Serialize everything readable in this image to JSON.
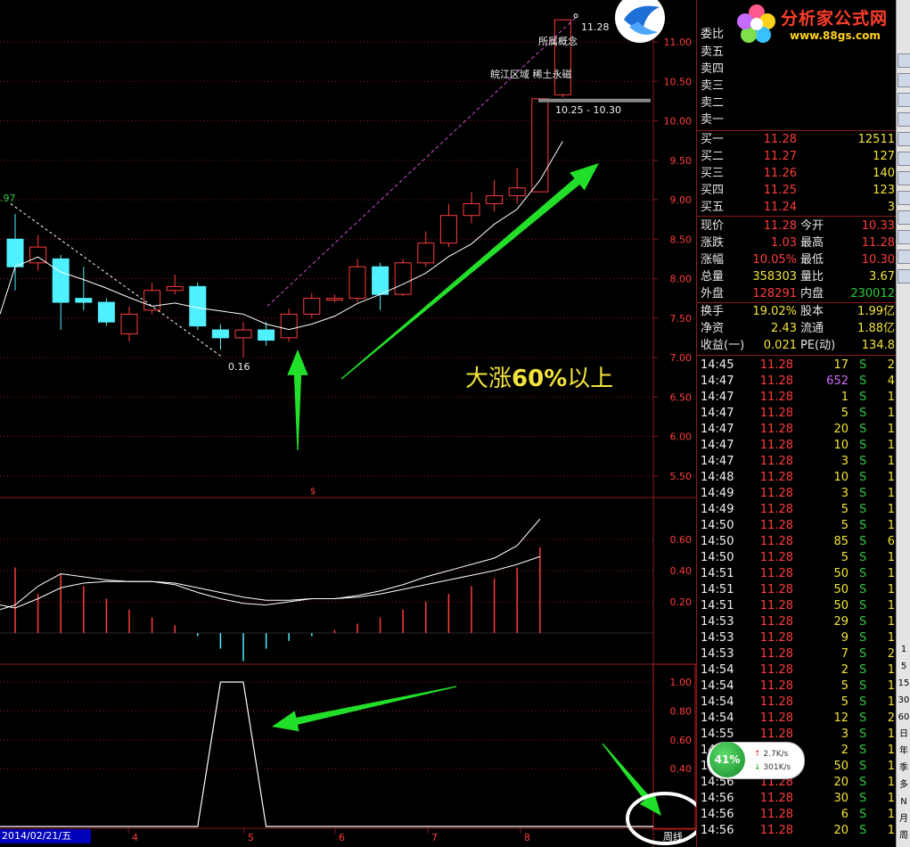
{
  "annotations": {
    "concept": "所属概念",
    "region": "皖江区域 稀土永磁",
    "high_price": "11.28",
    "range": "10.25 - 10.30",
    "low_price": "0.16",
    "left_price": ".97",
    "big_text_prefix": "大涨",
    "big_text_bold": "60%",
    "big_text_suffix": "以上",
    "dollar": "$",
    "period": "周线"
  },
  "x_axis": {
    "date": "2014/02/21/五",
    "ticks": [
      "4",
      "5",
      "6",
      "7",
      "8"
    ]
  },
  "price_axis": [
    "11.00",
    "10.50",
    "10.00",
    "9.50",
    "9.00",
    "8.50",
    "8.00",
    "7.50",
    "7.00",
    "6.50",
    "6.00",
    "5.50"
  ],
  "macd_axis": [
    "0.60",
    "0.40",
    "0.20"
  ],
  "ind_axis": [
    "1.00",
    "0.80",
    "0.60",
    "0.40"
  ],
  "colors": {
    "up": "#ff3c3c",
    "down": "#4ff0ff",
    "grid": "#8a1a1a",
    "ma": "#ffffff",
    "arrow": "#22e02a"
  },
  "logo": {
    "title": "分析家公式网",
    "url": "www.88gs.com"
  },
  "order_book": {
    "weibi_label": "委比",
    "asks": [
      {
        "label": "卖五"
      },
      {
        "label": "卖四"
      },
      {
        "label": "卖三"
      },
      {
        "label": "卖二"
      },
      {
        "label": "卖一"
      }
    ],
    "bids": [
      {
        "label": "买一",
        "price": "11.28",
        "vol": "12511"
      },
      {
        "label": "买二",
        "price": "11.27",
        "vol": "127"
      },
      {
        "label": "买三",
        "price": "11.26",
        "vol": "140"
      },
      {
        "label": "买四",
        "price": "11.25",
        "vol": "123"
      },
      {
        "label": "买五",
        "price": "11.24",
        "vol": "3"
      }
    ]
  },
  "stats": [
    {
      "l1": "现价",
      "v1": "11.28",
      "l2": "今开",
      "v2": "10.33"
    },
    {
      "l1": "涨跌",
      "v1": "1.03",
      "l2": "最高",
      "v2": "11.28"
    },
    {
      "l1": "涨幅",
      "v1": "10.05%",
      "l2": "最低",
      "v2": "10.30"
    },
    {
      "l1": "总量",
      "v1": "358303",
      "l2": "量比",
      "v2": "3.67"
    },
    {
      "l1": "外盘",
      "v1": "128291",
      "l2": "内盘",
      "v2": "230012"
    },
    {
      "l1": "换手",
      "v1": "19.02%",
      "l2": "股本",
      "v2": "1.99亿"
    },
    {
      "l1": "净资",
      "v1": "2.43",
      "l2": "流通",
      "v2": "1.88亿"
    },
    {
      "l1": "收益(一)",
      "v1": "0.021",
      "l2": "PE(动)",
      "v2": "134.8"
    }
  ],
  "ticks": [
    {
      "t": "14:45",
      "p": "11.28",
      "v": "17",
      "s": "S",
      "n": "2"
    },
    {
      "t": "14:47",
      "p": "11.28",
      "v": "652",
      "s": "S",
      "n": "4"
    },
    {
      "t": "14:47",
      "p": "11.28",
      "v": "1",
      "s": "S",
      "n": "1"
    },
    {
      "t": "14:47",
      "p": "11.28",
      "v": "5",
      "s": "S",
      "n": "1"
    },
    {
      "t": "14:47",
      "p": "11.28",
      "v": "20",
      "s": "S",
      "n": "1"
    },
    {
      "t": "14:47",
      "p": "11.28",
      "v": "10",
      "s": "S",
      "n": "1"
    },
    {
      "t": "14:47",
      "p": "11.28",
      "v": "3",
      "s": "S",
      "n": "1"
    },
    {
      "t": "14:48",
      "p": "11.28",
      "v": "10",
      "s": "S",
      "n": "1"
    },
    {
      "t": "14:49",
      "p": "11.28",
      "v": "3",
      "s": "S",
      "n": "1"
    },
    {
      "t": "14:49",
      "p": "11.28",
      "v": "5",
      "s": "S",
      "n": "1"
    },
    {
      "t": "14:50",
      "p": "11.28",
      "v": "5",
      "s": "S",
      "n": "1"
    },
    {
      "t": "14:50",
      "p": "11.28",
      "v": "85",
      "s": "S",
      "n": "6"
    },
    {
      "t": "14:50",
      "p": "11.28",
      "v": "5",
      "s": "S",
      "n": "1"
    },
    {
      "t": "14:51",
      "p": "11.28",
      "v": "50",
      "s": "S",
      "n": "1"
    },
    {
      "t": "14:51",
      "p": "11.28",
      "v": "50",
      "s": "S",
      "n": "1"
    },
    {
      "t": "14:51",
      "p": "11.28",
      "v": "50",
      "s": "S",
      "n": "1"
    },
    {
      "t": "14:53",
      "p": "11.28",
      "v": "29",
      "s": "S",
      "n": "1"
    },
    {
      "t": "14:53",
      "p": "11.28",
      "v": "9",
      "s": "S",
      "n": "1"
    },
    {
      "t": "14:53",
      "p": "11.28",
      "v": "7",
      "s": "S",
      "n": "2"
    },
    {
      "t": "14:54",
      "p": "11.28",
      "v": "2",
      "s": "S",
      "n": "1"
    },
    {
      "t": "14:54",
      "p": "11.28",
      "v": "5",
      "s": "S",
      "n": "1"
    },
    {
      "t": "14:54",
      "p": "11.28",
      "v": "5",
      "s": "S",
      "n": "1"
    },
    {
      "t": "14:54",
      "p": "11.28",
      "v": "12",
      "s": "S",
      "n": "2"
    },
    {
      "t": "14:55",
      "p": "11.28",
      "v": "3",
      "s": "S",
      "n": "1"
    },
    {
      "t": "14:55",
      "p": "11.28",
      "v": "2",
      "s": "S",
      "n": "1"
    },
    {
      "t": "14:55",
      "p": "11.28",
      "v": "50",
      "s": "S",
      "n": "1"
    },
    {
      "t": "14:56",
      "p": "11.28",
      "v": "20",
      "s": "S",
      "n": "1"
    },
    {
      "t": "14:56",
      "p": "11.28",
      "v": "30",
      "s": "S",
      "n": "1"
    },
    {
      "t": "14:56",
      "p": "11.28",
      "v": "6",
      "s": "S",
      "n": "1"
    },
    {
      "t": "14:56",
      "p": "11.28",
      "v": "20",
      "s": "S",
      "n": "1"
    }
  ],
  "speed": {
    "pct": "41%",
    "up": "2.7K/s",
    "down": "301K/s"
  },
  "toolbar": [
    "周",
    "月",
    "N",
    "多",
    "季",
    "年",
    "日",
    "60",
    "30",
    "15",
    "5",
    "1"
  ],
  "candles": [
    {
      "o": 8.5,
      "c": 8.15,
      "h": 8.82,
      "l": 7.85
    },
    {
      "o": 8.2,
      "c": 8.4,
      "h": 8.55,
      "l": 8.1
    },
    {
      "o": 8.25,
      "c": 7.7,
      "h": 8.3,
      "l": 7.35
    },
    {
      "o": 7.75,
      "c": 7.7,
      "h": 8.15,
      "l": 7.6
    },
    {
      "o": 7.7,
      "c": 7.45,
      "h": 7.75,
      "l": 7.4
    },
    {
      "o": 7.3,
      "c": 7.55,
      "h": 7.65,
      "l": 7.2
    },
    {
      "o": 7.6,
      "c": 7.85,
      "h": 7.95,
      "l": 7.55
    },
    {
      "o": 7.85,
      "c": 7.9,
      "h": 8.05,
      "l": 7.8
    },
    {
      "o": 7.9,
      "c": 7.4,
      "h": 7.95,
      "l": 7.35
    },
    {
      "o": 7.35,
      "c": 7.25,
      "h": 7.42,
      "l": 7.1
    },
    {
      "o": 7.25,
      "c": 7.35,
      "h": 7.45,
      "l": 7.0
    },
    {
      "o": 7.35,
      "c": 7.22,
      "h": 7.45,
      "l": 7.15
    },
    {
      "o": 7.25,
      "c": 7.55,
      "h": 7.62,
      "l": 7.2
    },
    {
      "o": 7.55,
      "c": 7.75,
      "h": 7.82,
      "l": 7.5
    },
    {
      "o": 7.75,
      "c": 7.75,
      "h": 7.8,
      "l": 7.7
    },
    {
      "o": 7.75,
      "c": 8.15,
      "h": 8.25,
      "l": 7.7
    },
    {
      "o": 8.15,
      "c": 7.8,
      "h": 8.2,
      "l": 7.6
    },
    {
      "o": 7.8,
      "c": 8.2,
      "h": 8.25,
      "l": 7.78
    },
    {
      "o": 8.2,
      "c": 8.45,
      "h": 8.6,
      "l": 8.15
    },
    {
      "o": 8.45,
      "c": 8.8,
      "h": 8.95,
      "l": 8.4
    },
    {
      "o": 8.8,
      "c": 8.95,
      "h": 9.1,
      "l": 8.7
    },
    {
      "o": 8.95,
      "c": 9.05,
      "h": 9.25,
      "l": 8.85
    },
    {
      "o": 9.05,
      "c": 9.15,
      "h": 9.4,
      "l": 8.95
    },
    {
      "o": 9.1,
      "c": 10.28,
      "h": 10.28,
      "l": 9.1
    },
    {
      "o": 10.33,
      "c": 11.28,
      "h": 11.28,
      "l": 10.3
    }
  ],
  "macd": [
    0.42,
    0.25,
    0.38,
    0.3,
    0.22,
    0.15,
    0.1,
    0.05,
    -0.02,
    -0.1,
    -0.18,
    -0.1,
    -0.05,
    -0.02,
    0.02,
    0.06,
    0.1,
    0.15,
    0.2,
    0.25,
    0.3,
    0.35,
    0.42,
    0.55
  ],
  "dif": [
    0.18,
    0.3,
    0.38,
    0.36,
    0.34,
    0.33,
    0.33,
    0.31,
    0.26,
    0.22,
    0.19,
    0.18,
    0.2,
    0.22,
    0.22,
    0.24,
    0.27,
    0.31,
    0.36,
    0.4,
    0.44,
    0.48,
    0.56,
    0.73
  ],
  "dea": [
    0.16,
    0.22,
    0.29,
    0.32,
    0.33,
    0.33,
    0.33,
    0.32,
    0.29,
    0.26,
    0.23,
    0.21,
    0.21,
    0.22,
    0.22,
    0.23,
    0.25,
    0.28,
    0.31,
    0.34,
    0.37,
    0.4,
    0.44,
    0.49
  ],
  "ind": [
    0,
    0,
    0,
    0,
    0,
    0,
    0,
    0,
    0,
    1,
    1,
    0,
    0,
    0,
    0,
    0,
    0,
    0,
    0,
    0,
    0,
    0,
    0,
    0,
    0
  ]
}
